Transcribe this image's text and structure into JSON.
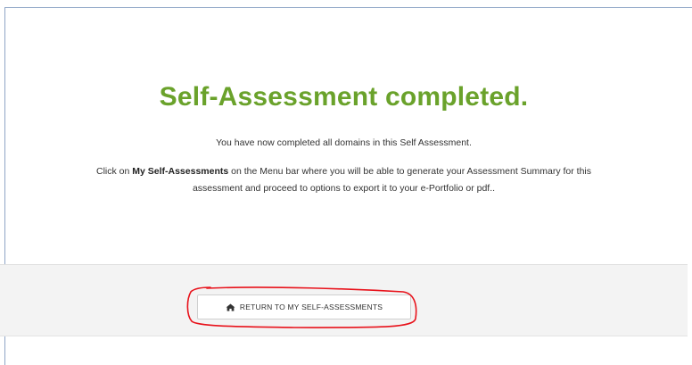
{
  "heading": "Self-Assessment completed.",
  "message": {
    "line1": "You have now completed all domains in this Self Assessment.",
    "line2_prefix": "Click on ",
    "line2_bold": "My Self-Assessments",
    "line2_mid": " on the Menu bar where you will be able to generate your Assessment Summary for this",
    "line3": "assessment and proceed to options to export it to your e-Portfolio or pdf.."
  },
  "footer": {
    "return_button_label": "RETURN TO MY SELF-ASSESSMENTS",
    "return_button_icon": "home-icon"
  },
  "colors": {
    "heading": "#6aa22b",
    "annotation": "#e8121b"
  }
}
